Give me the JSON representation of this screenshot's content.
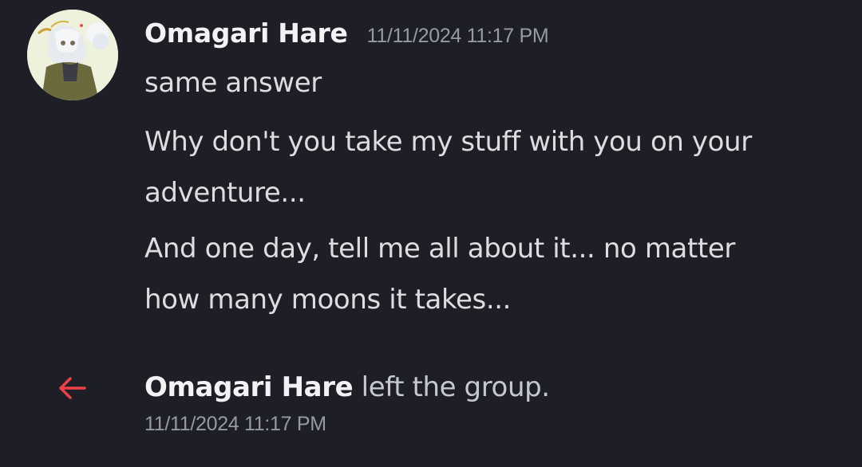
{
  "message": {
    "author": "Omagari Hare",
    "timestamp": "11/11/2024 11:17 PM",
    "lines": [
      "same answer",
      "Why don't you take my stuff with you on your adventure...",
      "And one day, tell me all about it... no matter how many moons it takes..."
    ],
    "line2_part1": "Why don't you take my stuff with you on your",
    "line2_part2": "adventure...",
    "line3_part1": "And one day, tell me all about it... no matter",
    "line3_part2": "how many moons it takes..."
  },
  "system_event": {
    "icon": "arrow-left-icon",
    "icon_color": "#ed4245",
    "author": "Omagari Hare",
    "action_text": " left the group.",
    "timestamp": "11/11/2024 11:17 PM"
  },
  "colors": {
    "background": "#1e1f26",
    "author_text": "#f2f3f5",
    "message_text": "#dbdee1",
    "timestamp_text": "#949ba4"
  }
}
